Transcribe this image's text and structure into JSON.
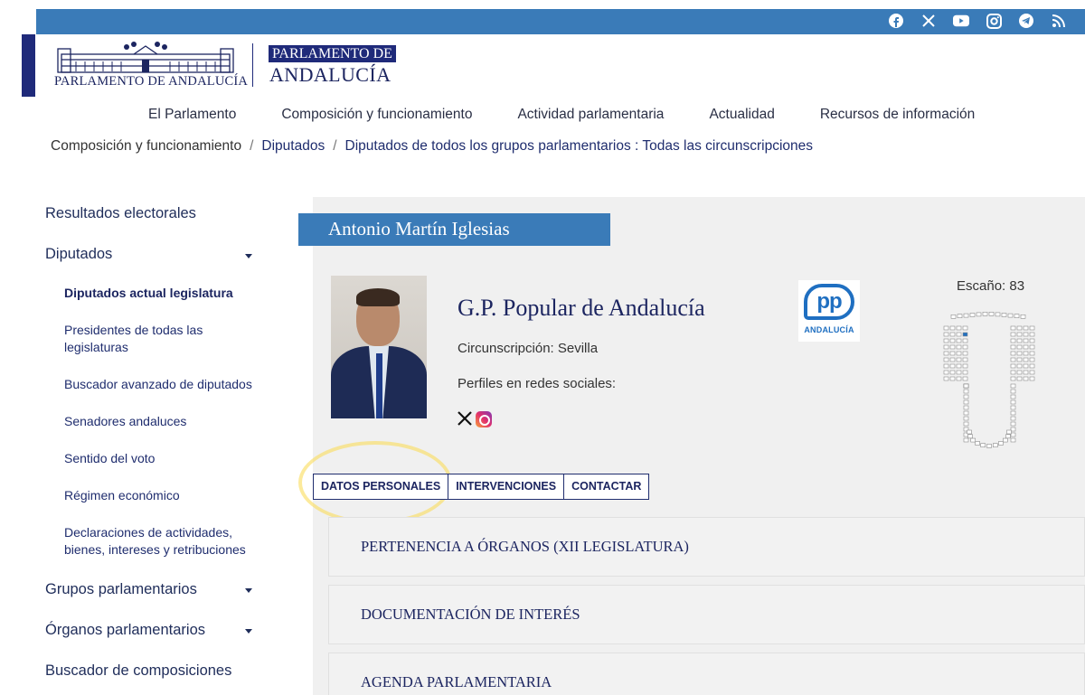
{
  "social": {
    "icons": [
      "facebook-icon",
      "x-icon",
      "youtube-icon",
      "instagram-icon",
      "telegram-icon",
      "rss-icon"
    ]
  },
  "logo": {
    "text": "PARLAMENTO DE ANDALUCÍA",
    "secondary_line1": "PARLAMENTO DE",
    "secondary_line2": "ANDALUCÍA"
  },
  "nav": {
    "items": [
      "El Parlamento",
      "Composición y funcionamiento",
      "Actividad parlamentaria",
      "Actualidad",
      "Recursos de información"
    ]
  },
  "breadcrumb": {
    "items": [
      "Composición y funcionamiento",
      "Diputados",
      "Diputados de todos los grupos parlamentarios : Todas las circunscripciones"
    ],
    "separator": "/"
  },
  "sidebar": {
    "resultados": "Resultados electorales",
    "diputados": "Diputados",
    "sub": [
      "Diputados actual legislatura",
      "Presidentes de todas las legislaturas",
      "Buscador avanzado de diputados",
      "Senadores andaluces",
      "Sentido del voto",
      "Régimen económico",
      "Declaraciones de actividades, bienes, intereses y retribuciones"
    ],
    "grupos": "Grupos parlamentarios",
    "organos": "Órganos parlamentarios",
    "buscador": "Buscador de composiciones"
  },
  "profile": {
    "name": "Antonio Martín Iglesias",
    "group": "G.P. Popular de Andalucía",
    "circunscripcion": "Circunscripción: Sevilla",
    "perfiles": "Perfiles en redes sociales:",
    "party_logo_text": "pp",
    "party_logo_sub": "ANDALUCÍA",
    "escano": "Escaño: 83"
  },
  "tabs": [
    "DATOS PERSONALES",
    "INTERVENCIONES",
    "CONTACTAR"
  ],
  "accordion": [
    "PERTENENCIA A ÓRGANOS (XII LEGISLATURA)",
    "DOCUMENTACIÓN DE INTERÉS",
    "AGENDA PARLAMENTARIA"
  ],
  "colors": {
    "brand_blue": "#3a7bb8",
    "navy": "#1f2a7a",
    "party_blue": "#1f6fc1",
    "highlight": "#fadc5a"
  }
}
